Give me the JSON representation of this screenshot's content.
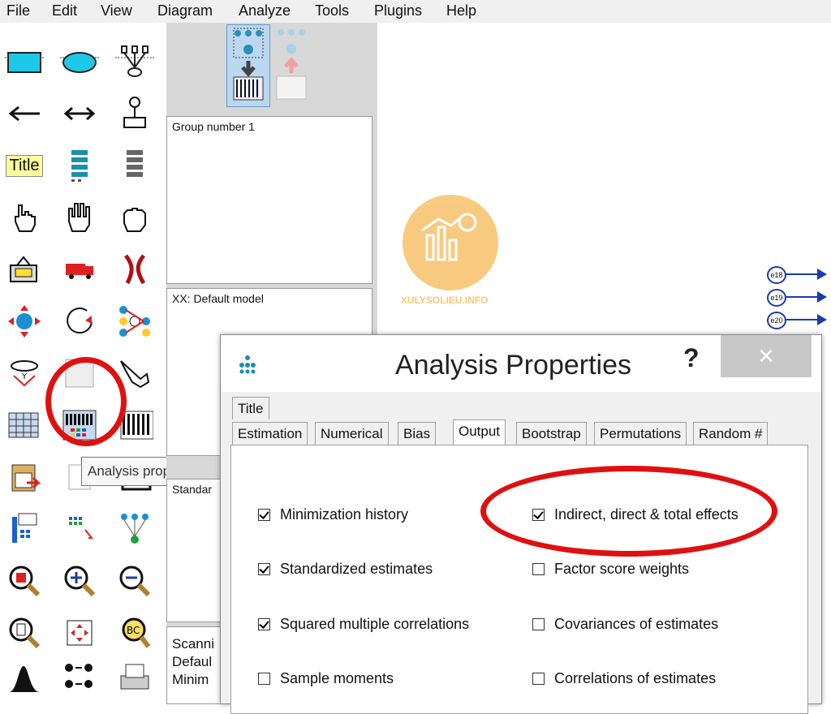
{
  "menu": [
    "File",
    "Edit",
    "View",
    "Diagram",
    "Analyze",
    "Tools",
    "Plugins",
    "Help"
  ],
  "toolbar_icons": [
    "rectangle-icon",
    "ellipse-icon",
    "indicator-tree-icon",
    "arrow-left-icon",
    "double-arrow-icon",
    "unique-variable-icon",
    "title-icon",
    "list-variables-model-icon",
    "list-variables-data-icon",
    "select-one-hand-icon",
    "select-all-hand-icon",
    "deselect-hand-icon",
    "duplicate-icon",
    "move-truck-icon",
    "erase-icon",
    "move-parameter-icon",
    "rotate-icon",
    "reflect-icon",
    "touch-up-icon",
    "analysis-properties-icon",
    "hand-pointer-icon",
    "data-files-icon",
    "analysis-properties-icon",
    "text-output-icon",
    "calculate-estimates-icon",
    "copy-clipboard-icon",
    "output-text-icon",
    "preserve-symmetries-icon",
    "zoom-in-icon",
    "zoom-out-icon",
    "zoom-page-icon",
    "resize-icon",
    "specification-search-icon",
    "bayesian-icon",
    "multigroup-icon",
    "print-icon"
  ],
  "title_icon_label": "Title",
  "groups_panel": {
    "label": "Group number 1"
  },
  "models_panel": {
    "label": "XX: Default model"
  },
  "partial_panel": {
    "label": "Standar"
  },
  "status_lines": [
    "Scanni",
    "Defaul",
    "Minim"
  ],
  "watermark": {
    "text": "XULYSOLIEU.INFO",
    "color": "#f5b54a"
  },
  "canvas_nodes": [
    "e18",
    "e19",
    "e20"
  ],
  "tooltip": "Analysis properties",
  "dialog": {
    "title": "Analysis Properties",
    "help": "?",
    "close": "×",
    "top_tab": "Title",
    "tabs": [
      "Estimation",
      "Numerical",
      "Bias",
      "Output",
      "Bootstrap",
      "Permutations",
      "Random #"
    ],
    "active_tab": "Output",
    "checkboxes_left": [
      {
        "label": "Minimization history",
        "checked": true
      },
      {
        "label": "Standardized estimates",
        "checked": true
      },
      {
        "label": "Squared multiple correlations",
        "checked": true
      },
      {
        "label": "Sample moments",
        "checked": false
      }
    ],
    "checkboxes_right": [
      {
        "label": "Indirect, direct & total effects",
        "checked": true
      },
      {
        "label": "Factor score weights",
        "checked": false
      },
      {
        "label": "Covariances of estimates",
        "checked": false
      },
      {
        "label": "Correlations of estimates",
        "checked": false
      }
    ]
  },
  "colors": {
    "highlight_ring": "#e01010",
    "icon_blue": "#1e9ad6",
    "title_yellow": "#ffff99"
  }
}
